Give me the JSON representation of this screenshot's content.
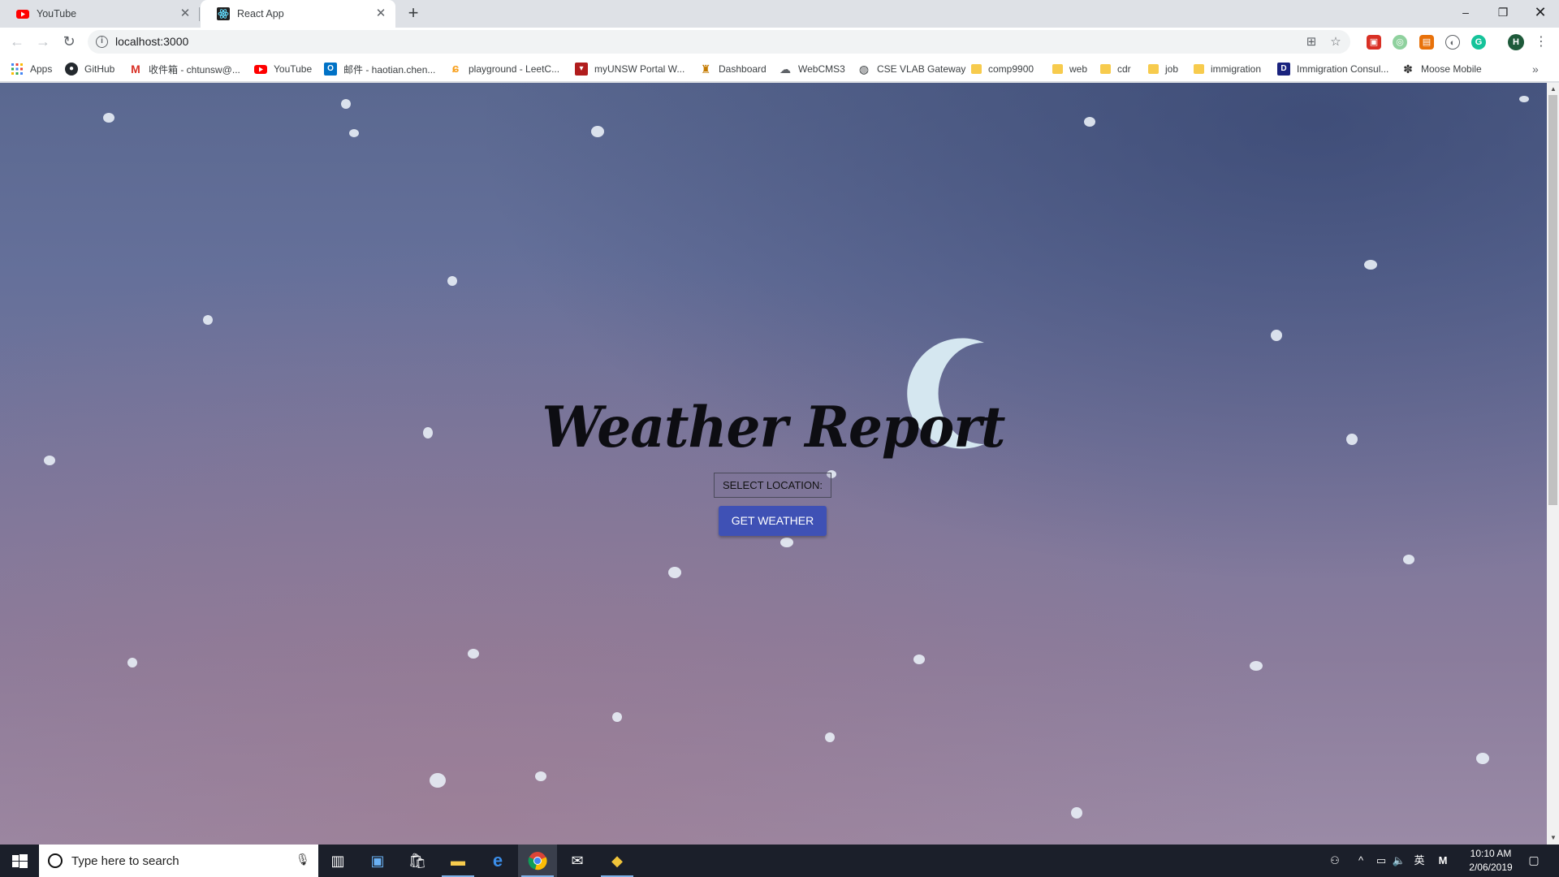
{
  "browser": {
    "tabs": [
      {
        "label": "YouTube",
        "active": false
      },
      {
        "label": "React App",
        "active": true
      }
    ],
    "new_tab_label": "+",
    "window_controls": {
      "minimize": "–",
      "maximize": "❐",
      "close": "✕"
    },
    "address": "localhost:3000",
    "profile_initial": "H",
    "bookmarks": [
      {
        "label": "Apps",
        "icon": "apps-grid-icon"
      },
      {
        "label": "GitHub",
        "icon": "github-icon"
      },
      {
        "label": "收件箱 - chtunsw@...",
        "icon": "gmail-icon"
      },
      {
        "label": "YouTube",
        "icon": "youtube-icon"
      },
      {
        "label": "邮件 - haotian.chen...",
        "icon": "outlook-icon"
      },
      {
        "label": "playground - LeetC...",
        "icon": "leetcode-icon"
      },
      {
        "label": "myUNSW Portal W...",
        "icon": "unsw-icon"
      },
      {
        "label": "Dashboard",
        "icon": "dashboard-icon"
      },
      {
        "label": "WebCMS3",
        "icon": "webcms-icon"
      },
      {
        "label": "CSE VLAB Gateway",
        "icon": "globe-icon"
      },
      {
        "label": "comp9900",
        "icon": "folder-icon"
      },
      {
        "label": "web",
        "icon": "folder-icon"
      },
      {
        "label": "cdr",
        "icon": "folder-icon"
      },
      {
        "label": "job",
        "icon": "folder-icon"
      },
      {
        "label": "immigration",
        "icon": "folder-icon"
      },
      {
        "label": "Immigration Consul...",
        "icon": "immigration-icon"
      },
      {
        "label": "Moose Mobile",
        "icon": "moose-icon"
      }
    ],
    "overflow_label": "»"
  },
  "app": {
    "title": "Weather Report",
    "select_location_label": "SELECT LOCATION:",
    "get_weather_label": "GET WEATHER",
    "background_colors": {
      "top": "#5a6890",
      "bottom": "#9a8aa6"
    },
    "button_color": "#3f51b5"
  },
  "taskbar": {
    "search_placeholder": "Type here to search",
    "time": "10:10 AM",
    "date": "2/06/2019",
    "ime_label": "英",
    "apps": [
      "task-view-icon",
      "file-explorer-icon",
      "store-icon",
      "folder-icon",
      "edge-icon",
      "chrome-icon",
      "mail-icon",
      "git-icon"
    ]
  }
}
